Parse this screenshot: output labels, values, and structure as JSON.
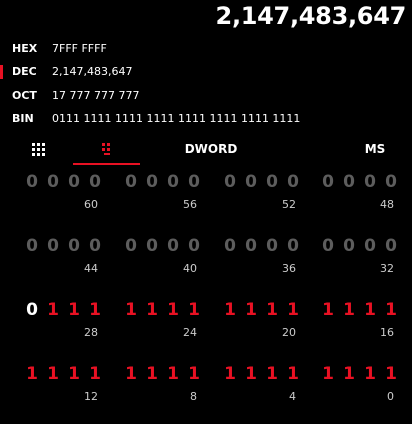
{
  "display": {
    "value": "2,147,483,647"
  },
  "radix": [
    {
      "name": "HEX",
      "value": "7FFF FFFF",
      "selected": false
    },
    {
      "name": "DEC",
      "value": "2,147,483,647",
      "selected": true
    },
    {
      "name": "OCT",
      "value": "17 777 777 777",
      "selected": false
    },
    {
      "name": "BIN",
      "value": "0111 1111 1111 1111 1111 1111 1111 1111",
      "selected": false
    }
  ],
  "tabs": {
    "keypad_icon": "keypad-grid-icon",
    "bit_toggle_icon": "bit-toggle-icon",
    "word_size": "DWORD",
    "memory": "MS"
  },
  "colors": {
    "accent": "#e81123",
    "bit_off": "#5d5d5d",
    "background": "#000000"
  },
  "bit_rows": [
    {
      "bits": [
        "0",
        "0",
        "0",
        "0",
        "0",
        "0",
        "0",
        "0",
        "0",
        "0",
        "0",
        "0",
        "0",
        "0",
        "0",
        "0"
      ],
      "positions": [
        "60",
        "56",
        "52",
        "48"
      ]
    },
    {
      "bits": [
        "0",
        "0",
        "0",
        "0",
        "0",
        "0",
        "0",
        "0",
        "0",
        "0",
        "0",
        "0",
        "0",
        "0",
        "0",
        "0"
      ],
      "positions": [
        "44",
        "40",
        "36",
        "32"
      ]
    },
    {
      "bits": [
        "0",
        "1",
        "1",
        "1",
        "1",
        "1",
        "1",
        "1",
        "1",
        "1",
        "1",
        "1",
        "1",
        "1",
        "1",
        "1"
      ],
      "positions": [
        "28",
        "24",
        "20",
        "16"
      ]
    },
    {
      "bits": [
        "1",
        "1",
        "1",
        "1",
        "1",
        "1",
        "1",
        "1",
        "1",
        "1",
        "1",
        "1",
        "1",
        "1",
        "1",
        "1"
      ],
      "positions": [
        "12",
        "8",
        "4",
        "0"
      ]
    }
  ]
}
